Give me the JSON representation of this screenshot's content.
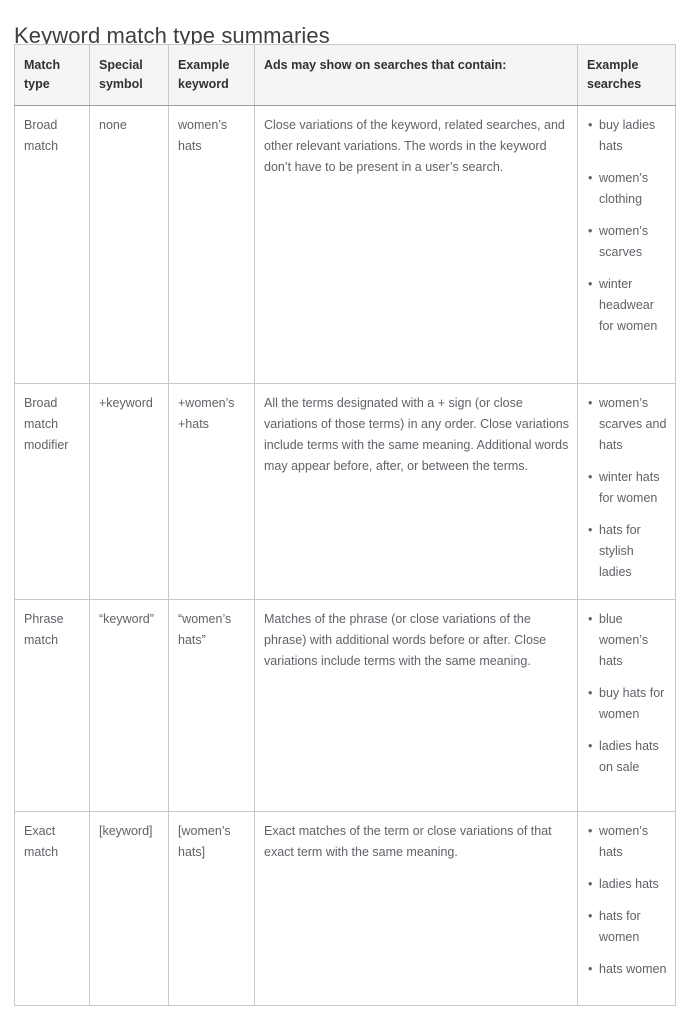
{
  "page": {
    "title": "Keyword match type summaries"
  },
  "table": {
    "columns": [
      {
        "key": "match_type",
        "label": "Match\ntype"
      },
      {
        "key": "special_symbol",
        "label": "Special\nsymbol"
      },
      {
        "key": "example_keyword",
        "label": "Example\nkeyword"
      },
      {
        "key": "description",
        "label": "Ads may show on searches that contain:"
      },
      {
        "key": "example_searches",
        "label": "Example\nsearches"
      }
    ],
    "rows": [
      {
        "match_type": "Broad\nmatch",
        "special_symbol": "none",
        "example_keyword": "women’s\nhats",
        "description": "Close variations of the keyword, related searches, and other relevant variations. The words in the keyword don’t have to be present in a user’s search.",
        "example_searches": [
          "buy ladies hats",
          "women’s clothing",
          "women’s scarves",
          "winter headwear for women"
        ]
      },
      {
        "match_type": "Broad\nmatch\nmodifier",
        "special_symbol": "+keyword",
        "example_keyword": "+women’s\n+hats",
        "description": "All the terms designated with a + sign (or close variations of those terms) in any order. Close variations include terms with the same meaning. Additional words may appear before, after, or between the terms.",
        "example_searches": [
          "women’s scarves and hats",
          "winter hats for women",
          "hats for stylish ladies"
        ]
      },
      {
        "match_type": "Phrase\nmatch",
        "special_symbol": "“keyword”",
        "example_keyword": "“women’s\nhats”",
        "description": "Matches of the phrase (or close variations of the phrase) with additional words before or after. Close variations include terms with the same meaning.",
        "example_searches": [
          "blue women’s hats",
          "buy hats for women",
          "ladies hats on sale"
        ]
      },
      {
        "match_type": "Exact\nmatch",
        "special_symbol": "[keyword]",
        "example_keyword": "[women’s\nhats]",
        "description": "Exact matches of the term or close variations of that exact term with the same meaning.",
        "example_searches": [
          "women’s hats",
          "ladies hats",
          "hats for women",
          "hats women"
        ]
      }
    ]
  },
  "colors": {
    "header_background": "#f5f5f5",
    "header_text": "#2f3133",
    "body_text": "#5f6368",
    "title_text": "#3c4043",
    "border": "#c8c8c8",
    "outer_border": "#9e9e9e"
  }
}
